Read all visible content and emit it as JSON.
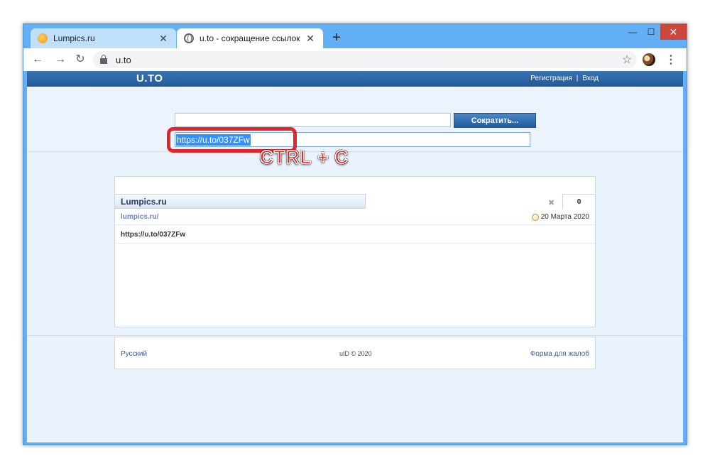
{
  "browser": {
    "tabs": [
      {
        "title": "Lumpics.ru",
        "icon": "orange-favicon-icon",
        "active": false
      },
      {
        "title": "u.to - сокращение ссылок",
        "icon": "globe-icon",
        "active": true
      }
    ],
    "new_tab": "+",
    "window_controls": {
      "minimize": "—",
      "maximize": "☐",
      "close": "✕"
    },
    "nav": {
      "back": "←",
      "forward": "→",
      "reload": "↻"
    },
    "address": "u.to",
    "bookmark": "☆",
    "menu": "⋮"
  },
  "site": {
    "logo": "U.TO",
    "register_label": "Регистрация",
    "separator": "|",
    "login_label": "Вход",
    "url_input_value": "",
    "shorten_label": "Сократить...",
    "result_value": "https://u.to/037ZFw"
  },
  "annotation": {
    "hotkey_label": "CTRL + C",
    "highlight_color": "#e3262b"
  },
  "links_panel": {
    "tab_title": "Lumpics.ru",
    "delete_icon": "✖",
    "count": "0",
    "source_url": "lumpics.ru/",
    "date": "20 Марта 2020",
    "short_url": "https://u.to/037ZFw"
  },
  "footer": {
    "language": "Русский",
    "copyright": "uID © 2020",
    "complaint_link": "Форма для жалоб"
  }
}
